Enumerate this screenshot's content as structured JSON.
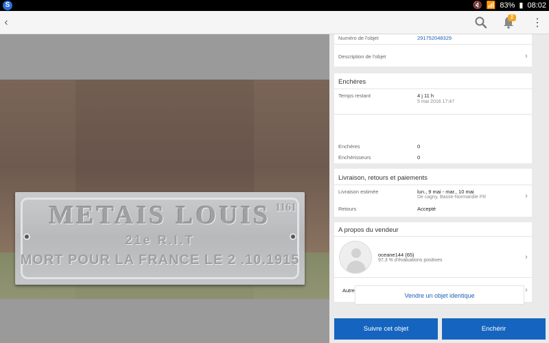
{
  "status_bar": {
    "battery": "83%",
    "time": "08:02"
  },
  "appbar": {
    "notifications_badge": "2"
  },
  "photo": {
    "plaque_line1": "METAIS LOUIS",
    "plaque_number": "1161",
    "plaque_line2": "21e R.I.T",
    "plaque_line3": "MORT POUR LA FRANCE LE 2 .10.1915"
  },
  "item": {
    "number_label": "Numéro de l'objet",
    "number_value": "291752048329",
    "description_label": "Description de l'objet"
  },
  "auction": {
    "title": "Enchères",
    "time_remaining_label": "Temps restant",
    "time_remaining_value": "4 j 11 h",
    "end_date": "5 mai 2016 17:47",
    "bids_label": "Enchères",
    "bids_value": "0",
    "bidders_label": "Enchérisseurs",
    "bidders_value": "0"
  },
  "shipping": {
    "title": "Livraison, retours et paiements",
    "delivery_label": "Livraison estimée",
    "delivery_value": "lun., 9 mai - mar., 10 mai",
    "delivery_from": "De cagny, Basse-Normandie FR",
    "returns_label": "Retours",
    "returns_value": "Accepté"
  },
  "seller": {
    "title": "A propos du vendeur",
    "name": "oceane144 (65)",
    "rating": "97,3 % d'évaluations positives",
    "other_items": "Autres objets du vendeur"
  },
  "actions": {
    "sell_similar": "Vendre un objet identique",
    "watch": "Suivre cet objet",
    "bid": "Enchérir"
  },
  "colors": {
    "primary_blue": "#1565c0",
    "link_blue": "#1a5fb4",
    "badge_orange": "#f5a623"
  }
}
